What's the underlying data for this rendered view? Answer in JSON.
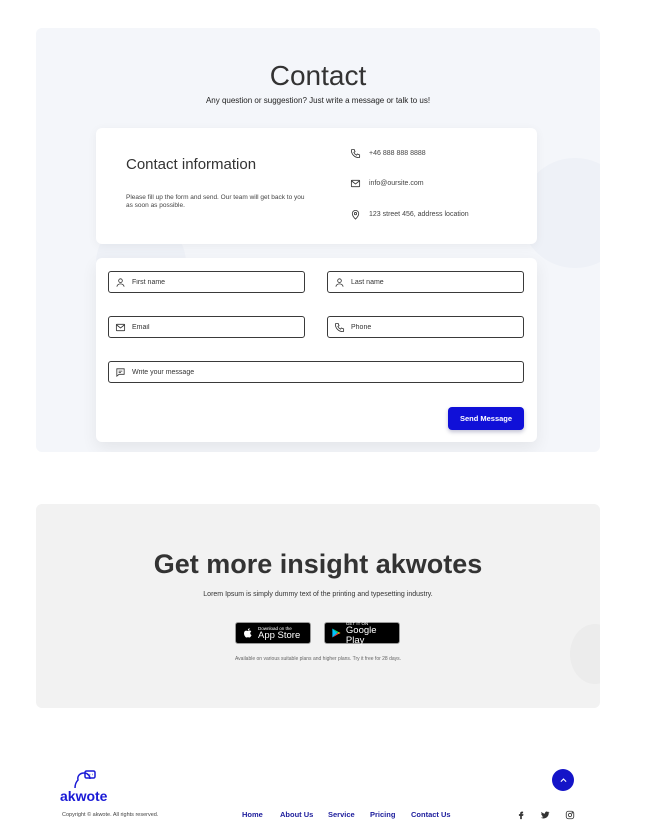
{
  "contact": {
    "title": "Contact",
    "subtitle": "Any question or suggestion? Just write a message or talk to us!",
    "info": {
      "title": "Contact information",
      "description": "Please fill up the form and send. Our team will get back to you as soon as possible.",
      "phone": "+46 888 888 8888",
      "email": "info@oursite.com",
      "address": "123 street 456, address location"
    },
    "form": {
      "first_name_placeholder": "First name",
      "last_name_placeholder": "Last name",
      "email_placeholder": "Email",
      "phone_placeholder": "Phone",
      "message_placeholder": "Write your message",
      "send_label": "Send Message"
    }
  },
  "insight": {
    "title": "Get more insight akwotes",
    "subtitle": "Lorem Ipsum is simply dummy text of the printing and typesetting industry.",
    "app_store": {
      "small": "Download on the",
      "big": "App Store"
    },
    "google_play": {
      "small": "GET IT ON",
      "big": "Google Play"
    },
    "note": "Available on various suitable plans and higher plans. Try it free for 28 days."
  },
  "footer": {
    "logo": "akwote",
    "copyright": "Copyright ©  akwote. All rights reserved.",
    "nav": [
      "Home",
      "About Us",
      "Service",
      "Pricing",
      "Contact Us"
    ],
    "social_icons": [
      "facebook-icon",
      "twitter-icon",
      "instagram-icon"
    ]
  },
  "colors": {
    "accent": "#1010d8",
    "nav_text": "#1c1c9c",
    "panel_bg": "#f4f6fa"
  }
}
